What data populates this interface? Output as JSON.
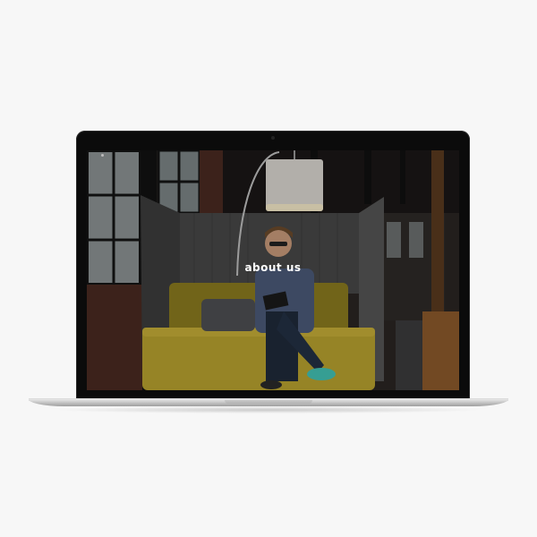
{
  "hero": {
    "title": "about us"
  },
  "icons": {
    "menu": "menu-dot-icon"
  },
  "colors": {
    "page_background": "#f7f7f7",
    "sofa": "#b8a12f",
    "sneaker": "#43c1b4",
    "bezel": "#0b0b0b"
  }
}
